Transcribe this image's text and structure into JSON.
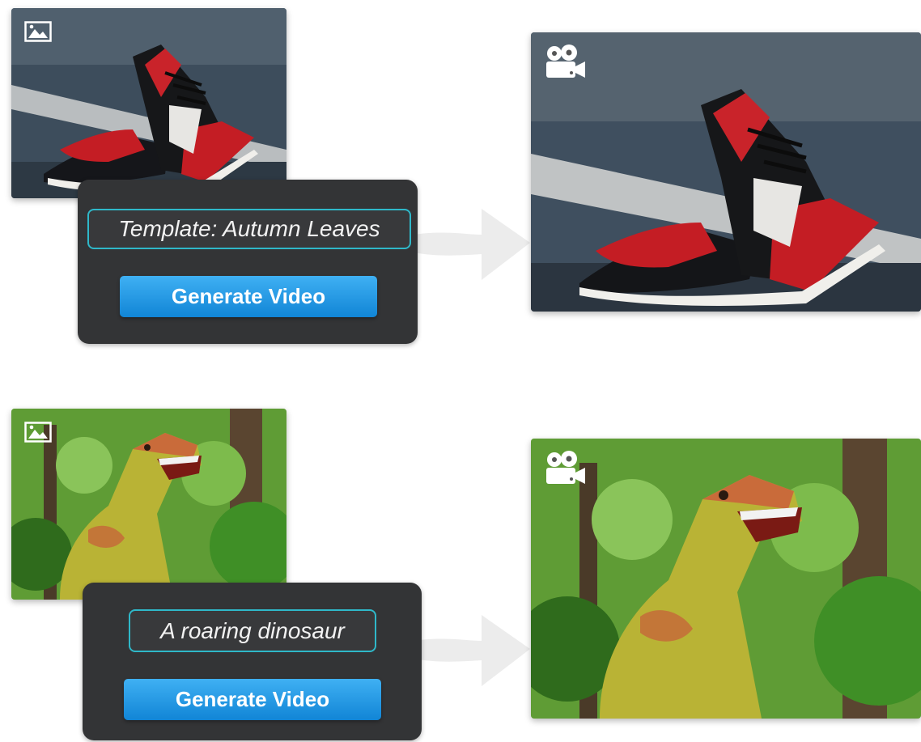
{
  "examples": [
    {
      "input_icon": "image-icon",
      "prompt": "Template: Autumn Leaves",
      "button_label": "Generate Video",
      "output_icon": "video-camera-icon",
      "subject": "red-black-white sneakers"
    },
    {
      "input_icon": "image-icon",
      "prompt": "A roaring dinosaur",
      "button_label": "Generate Video",
      "output_icon": "video-camera-icon",
      "subject": "dinosaur in forest"
    }
  ],
  "colors": {
    "panel": "#333436",
    "prompt_border": "#2fb8c9",
    "button": "#1b8fe0",
    "arrow": "#ececec"
  }
}
